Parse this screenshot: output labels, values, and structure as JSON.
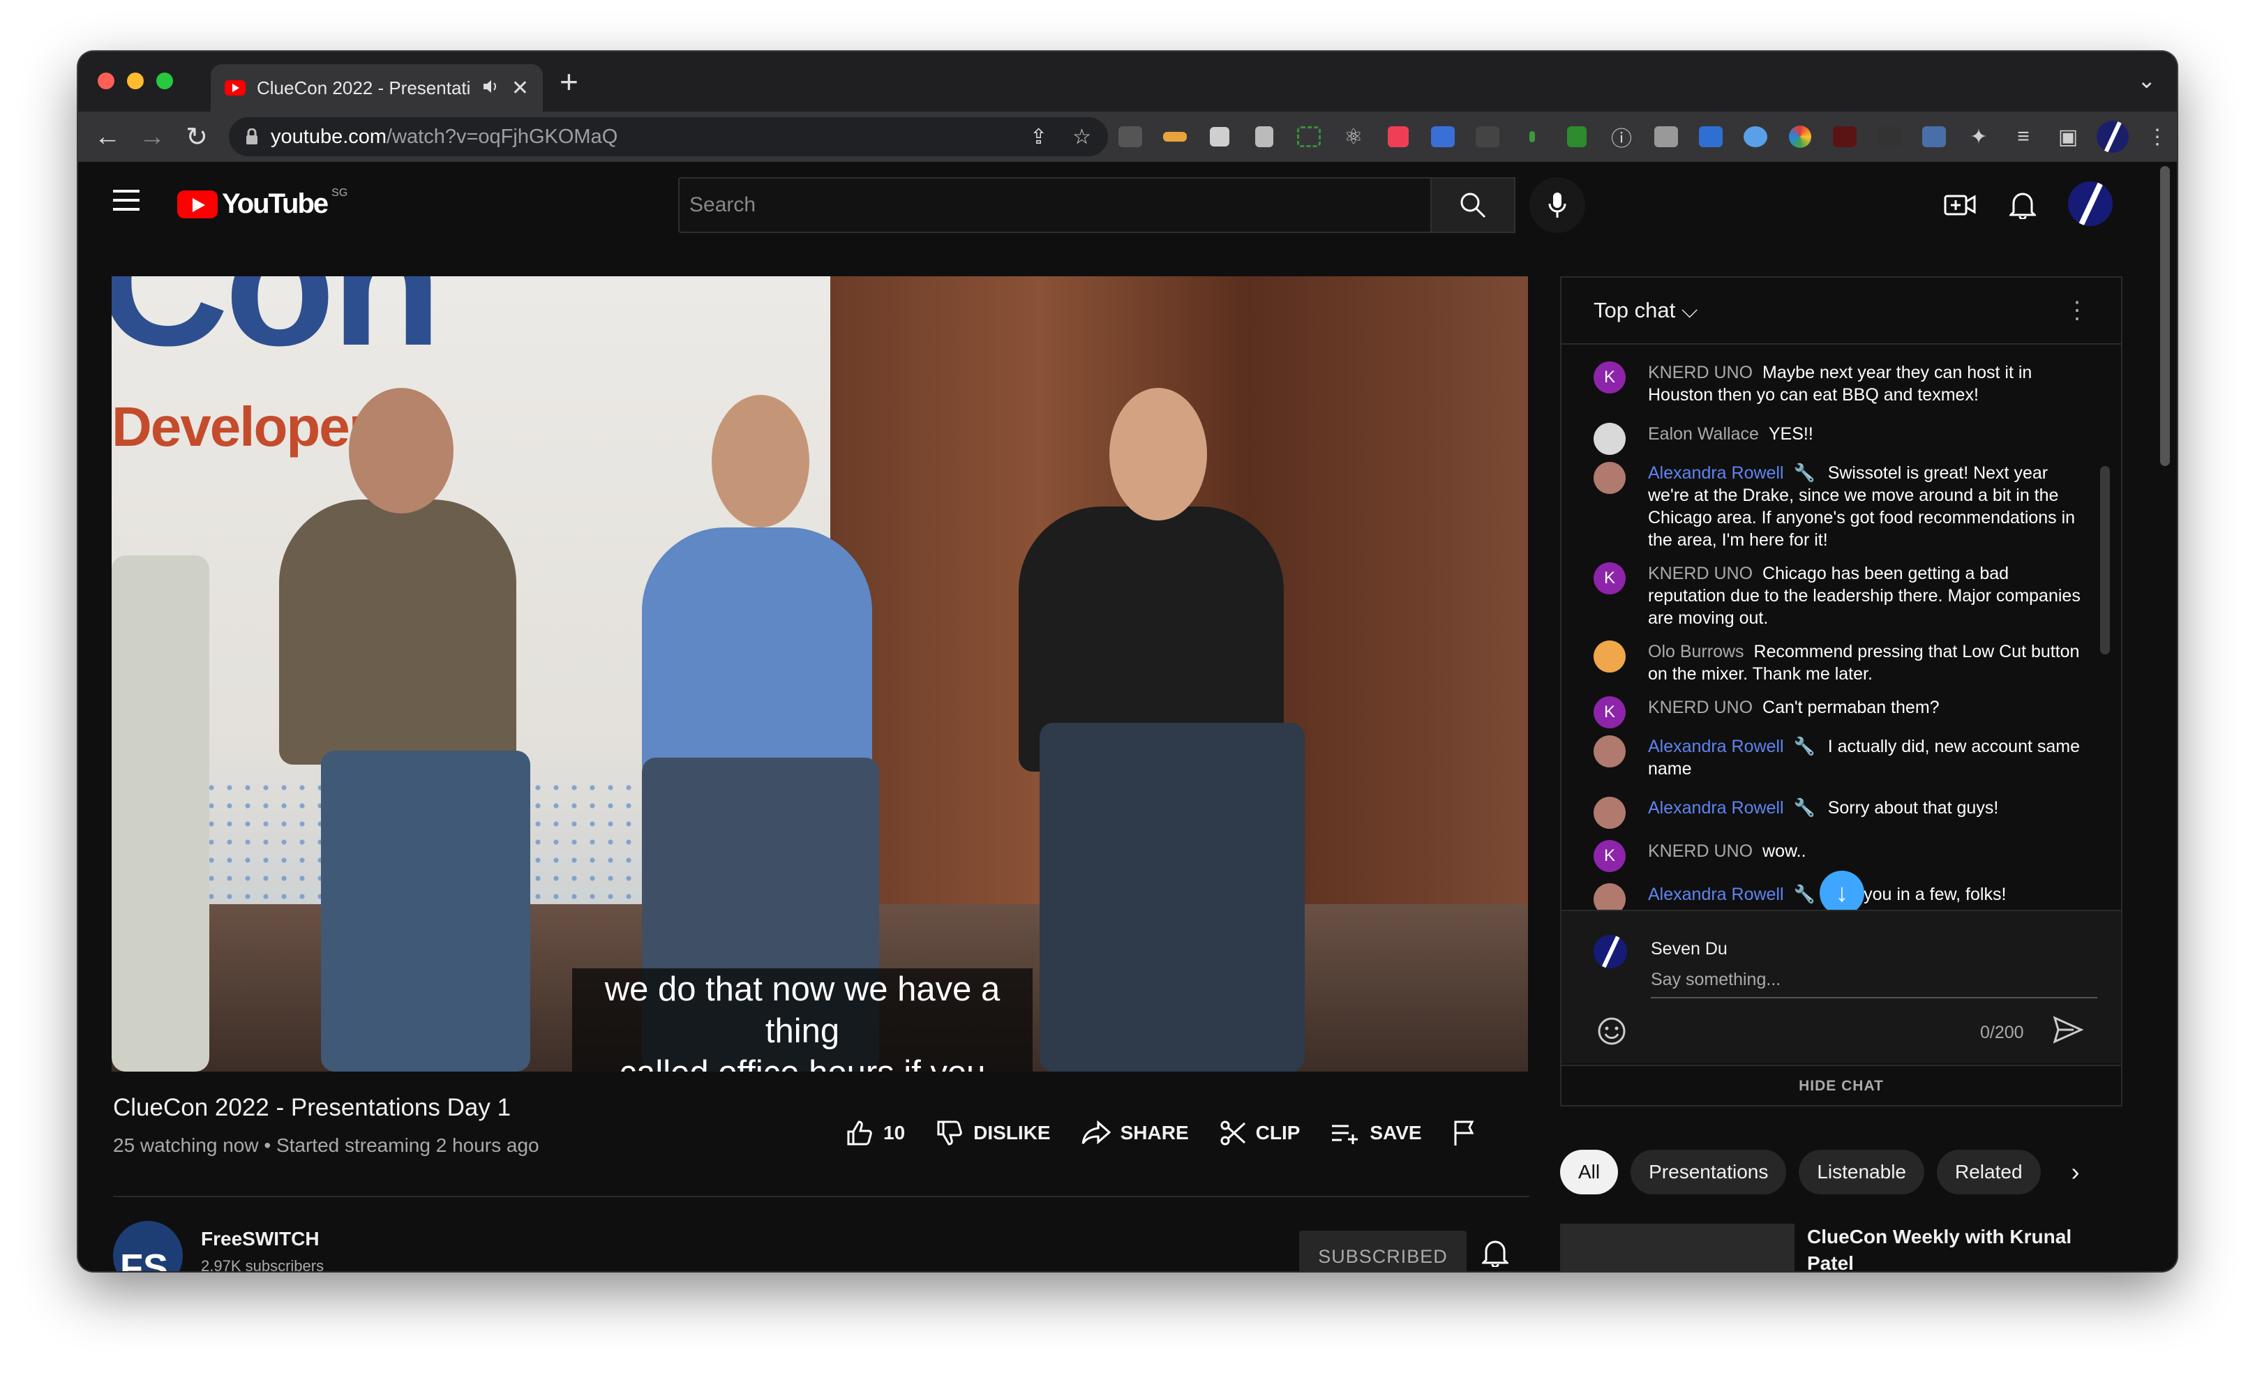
{
  "browser": {
    "tab_title": "ClueCon 2022 - Presentati",
    "url_host": "youtube.com",
    "url_path": "/watch?v=oqFjhGKOMaQ"
  },
  "header": {
    "logo_word": "YouTube",
    "country_code": "SG",
    "search_placeholder": "Search"
  },
  "video": {
    "banner_big": "Con",
    "banner_sub": "Developers",
    "caption_line1": "we do that now we have a thing",
    "caption_line2": "called office hours if you don't",
    "title": "ClueCon 2022 - Presentations Day 1",
    "meta": "25 watching now • Started streaming 2 hours ago",
    "actions": {
      "like_count": "10",
      "dislike": "DISLIKE",
      "share": "SHARE",
      "clip": "CLIP",
      "save": "SAVE"
    }
  },
  "channel": {
    "name": "FreeSWITCH",
    "subs": "2.97K subscribers",
    "subscribed_label": "SUBSCRIBED"
  },
  "chat": {
    "header": "Top chat",
    "messages": [
      {
        "author": "KNERD UNO",
        "initial": "K",
        "text": "Maybe next year they can host it in Houston then yo can eat BBQ and texmex!",
        "mod": false,
        "avatar_color": "#8e24aa"
      },
      {
        "author": "Ealon Wallace",
        "initial": "",
        "text": "YES!!",
        "mod": false,
        "avatar_color": "#d9d9d9"
      },
      {
        "author": "Alexandra Rowell",
        "initial": "",
        "text": "Swissotel is great! Next year we're at the Drake, since we move around a bit in the Chicago area. If anyone's got food recommendations in the area, I'm here for it!",
        "mod": true,
        "avatar_color": "#b07a6e"
      },
      {
        "author": "KNERD UNO",
        "initial": "K",
        "text": "Chicago has been getting a bad reputation due to the leadership there. Major companies are moving out.",
        "mod": false,
        "avatar_color": "#8e24aa"
      },
      {
        "author": "Olo Burrows",
        "initial": "",
        "text": "Recommend pressing that Low Cut button on the mixer. Thank me later.",
        "mod": false,
        "avatar_color": "#f0a64a"
      },
      {
        "author": "KNERD UNO",
        "initial": "K",
        "text": "Can't permaban them?",
        "mod": false,
        "avatar_color": "#8e24aa"
      },
      {
        "author": "Alexandra Rowell",
        "initial": "",
        "text": "I actually did, new account same name",
        "mod": true,
        "avatar_color": "#b07a6e"
      },
      {
        "author": "Alexandra Rowell",
        "initial": "",
        "text": "Sorry about that guys!",
        "mod": true,
        "avatar_color": "#b07a6e"
      },
      {
        "author": "KNERD UNO",
        "initial": "K",
        "text": "wow..",
        "mod": false,
        "avatar_color": "#8e24aa"
      },
      {
        "author": "Alexandra Rowell",
        "initial": "",
        "text": "See you in a few, folks!",
        "mod": true,
        "avatar_color": "#b07a6e"
      }
    ],
    "me_name": "Seven Du",
    "input_placeholder": "Say something...",
    "char_count": "0/200",
    "hide_chat": "HIDE CHAT"
  },
  "chips": [
    "All",
    "Presentations",
    "Listenable",
    "Related"
  ],
  "related": {
    "title": "ClueCon Weekly with Krunal Patel"
  }
}
